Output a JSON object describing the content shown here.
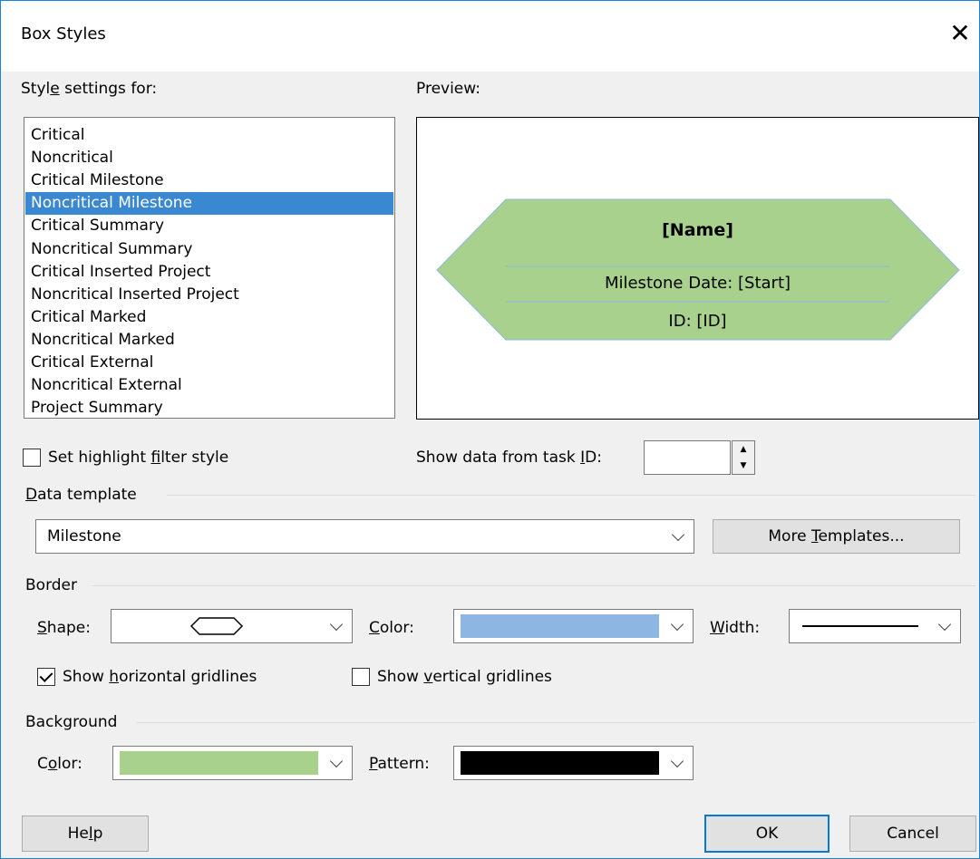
{
  "dialog": {
    "title": "Box Styles",
    "close_glyph": "✕"
  },
  "style_settings": {
    "label_pre": "Styl",
    "label_u": "e",
    "label_post": " settings for:",
    "items": [
      "Critical",
      "Noncritical",
      "Critical Milestone",
      "Noncritical Milestone",
      "Critical Summary",
      "Noncritical Summary",
      "Critical Inserted Project",
      "Noncritical Inserted Project",
      "Critical Marked",
      "Noncritical Marked",
      "Critical External",
      "Noncritical External",
      "Project Summary"
    ],
    "selected_index": 3
  },
  "preview": {
    "label": "Preview:",
    "name_line": "[Name]",
    "date_line": "Milestone Date: [Start]",
    "id_line": "ID: [ID]"
  },
  "highlight": {
    "label_pre": "Set highlight ",
    "label_u": "f",
    "label_post": "ilter style",
    "checked": false
  },
  "task_id": {
    "label_pre": "Show data from task ",
    "label_u": "I",
    "label_post": "D:",
    "value": ""
  },
  "data_template": {
    "label_u": "D",
    "label_post": "ata template",
    "value": "Milestone",
    "more_pre": "More ",
    "more_u": "T",
    "more_post": "emplates..."
  },
  "border": {
    "label": "Border",
    "shape_label_u": "S",
    "shape_label_post": "hape:",
    "color_label_u": "C",
    "color_label_post": "olor:",
    "color_value": "#8db6e2",
    "width_label_u": "W",
    "width_label_post": "idth:",
    "horizontal_pre": "Show ",
    "horizontal_u": "h",
    "horizontal_post": "orizontal gridlines",
    "horizontal_checked": true,
    "vertical_pre": "Show ",
    "vertical_u": "v",
    "vertical_post": "ertical gridlines",
    "vertical_checked": false
  },
  "background": {
    "label": "Background",
    "color_label_pre": "C",
    "color_label_u": "o",
    "color_label_post": "lor:",
    "color_value": "#a9d18e",
    "pattern_label_u": "P",
    "pattern_label_post": "attern:",
    "pattern_value": "#000000"
  },
  "buttons": {
    "help_pre": "He",
    "help_u": "l",
    "help_post": "p",
    "ok": "OK",
    "cancel": "Cancel"
  },
  "colors": {
    "selection": "#3b88d2",
    "milestone_fill": "#a9d18e",
    "milestone_stroke": "#8db6e2",
    "accent_border": "#1883d7"
  }
}
